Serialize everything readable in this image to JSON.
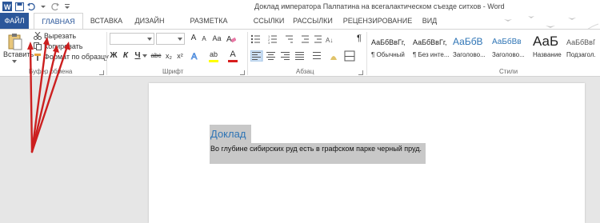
{
  "window": {
    "title": "Доклад императора Палпатина на всегалактическом съезде ситхов - Word"
  },
  "tabs": [
    {
      "label": "ФАЙЛ"
    },
    {
      "label": "ГЛАВНАЯ"
    },
    {
      "label": "ВСТАВКА"
    },
    {
      "label": "ДИЗАЙН"
    },
    {
      "label": "РАЗМЕТКА СТРАНИЦЫ"
    },
    {
      "label": "ССЫЛКИ"
    },
    {
      "label": "РАССЫЛКИ"
    },
    {
      "label": "РЕЦЕНЗИРОВАНИЕ"
    },
    {
      "label": "ВИД"
    }
  ],
  "clipboard": {
    "paste": "Вставить",
    "cut": "Вырезать",
    "copy": "Копировать",
    "format_painter": "Формат по образцу",
    "group_label": "Буфер обмена"
  },
  "font": {
    "group_label": "Шрифт",
    "bold": "Ж",
    "italic": "К",
    "underline": "Ч",
    "strike": "abc",
    "sub": "x₂",
    "sup": "x²",
    "highlight": "ab",
    "color": "A",
    "grow": "A",
    "shrink": "A",
    "case": "Aa",
    "clear": "A"
  },
  "paragraph": {
    "group_label": "Абзац",
    "pilcrow": "¶"
  },
  "styles": {
    "group_label": "Стили",
    "items": [
      {
        "preview": "АаБбВвГг,",
        "name": "¶ Обычный"
      },
      {
        "preview": "АаБбВвГг,",
        "name": "¶ Без инте..."
      },
      {
        "preview": "АаБбВ",
        "name": "Заголово..."
      },
      {
        "preview": "АаБбВв",
        "name": "Заголово..."
      },
      {
        "preview": "АаБ",
        "name": "Название"
      },
      {
        "preview": "АаБбВвГ",
        "name": "Подзагол..."
      }
    ]
  },
  "document": {
    "heading": "Доклад",
    "body": "Во глубине сибирских руд есть в графском парке черный пруд."
  },
  "colors": {
    "accent": "#2b579a",
    "heading": "#2e74b5",
    "selection": "#c8c8c8",
    "arrow": "#cc1f1f"
  }
}
